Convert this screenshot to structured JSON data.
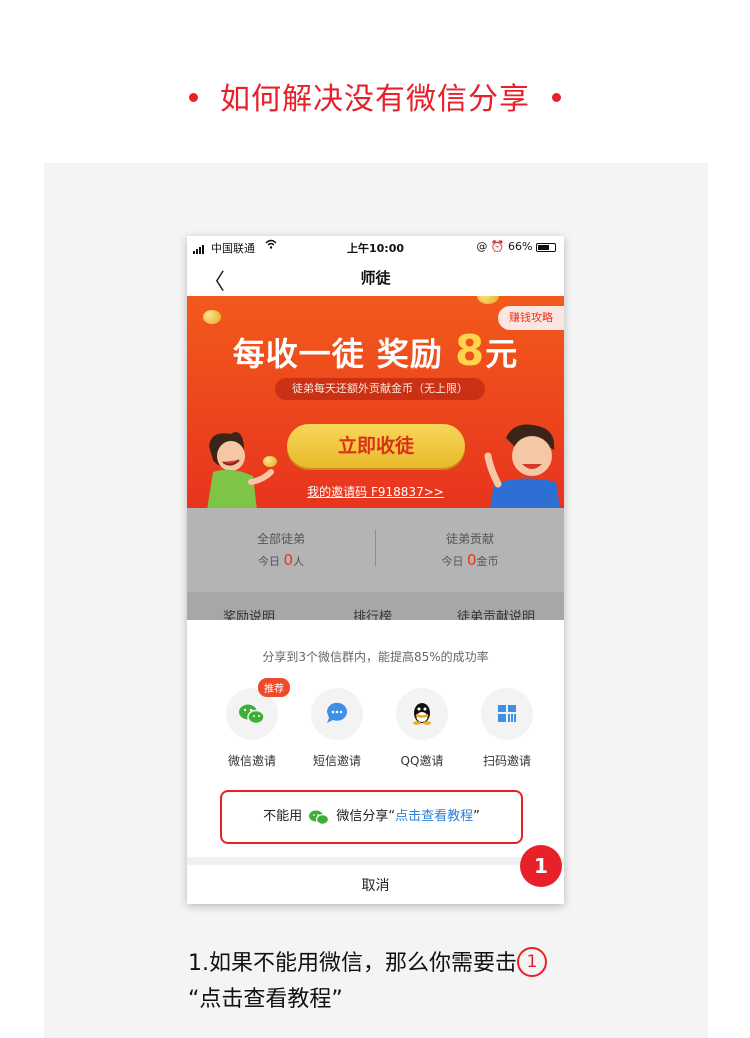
{
  "page": {
    "heading": "如何解决没有微信分享"
  },
  "status_bar": {
    "carrier": "中国联通",
    "time": "上午10:00",
    "battery": "66%"
  },
  "navbar": {
    "back": "〈",
    "title": "师徒"
  },
  "banner": {
    "tip_button": "赚钱攻略",
    "headline_prefix": "每收一徒 奖励 ",
    "headline_amount": "8",
    "headline_suffix": "元",
    "subline": "徒弟每天还额外贡献金币（无上限）",
    "cta": "立即收徒",
    "invite_code": "我的邀请码  F918837>>"
  },
  "stats": [
    {
      "label": "全部徒弟",
      "prefix": "今日 ",
      "value": "0",
      "unit": "人"
    },
    {
      "label": "徒弟贡献",
      "prefix": "今日 ",
      "value": "0",
      "unit": "金币"
    }
  ],
  "tabs": [
    "奖励说明",
    "排行榜",
    "徒弟贡献说明"
  ],
  "share_sheet": {
    "hint": "分享到3个微信群内，能提高85%的成功率",
    "options": [
      {
        "label": "微信邀请",
        "icon": "wechat-icon",
        "badge": "推荐"
      },
      {
        "label": "短信邀请",
        "icon": "sms-icon"
      },
      {
        "label": "QQ邀请",
        "icon": "qq-icon"
      },
      {
        "label": "扫码邀请",
        "icon": "qrcode-icon"
      }
    ],
    "fallback_prefix": "不能用",
    "fallback_mid": "微信分享“",
    "fallback_link": "点击查看教程",
    "fallback_suffix": "”",
    "cancel": "取消"
  },
  "step_marker": "1",
  "caption": {
    "line1": "1.如果不能用微信，那么你需要击",
    "ring": "1",
    "line2": "“点击查看教程”"
  },
  "colors": {
    "accent": "#e8202a",
    "banner": "#ef4a1e",
    "link": "#2f7ed8",
    "wechat": "#3cb034"
  }
}
